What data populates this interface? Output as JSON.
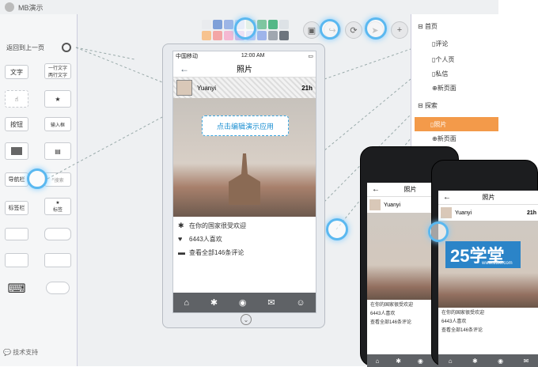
{
  "app": {
    "title": "MB演示",
    "support": "技术支持"
  },
  "sidebar": {
    "back": "返回到上一页",
    "text": "文字",
    "twoline": "一行文字\n两行文字",
    "button": "按钮",
    "input": "输入框",
    "navbar": "导航栏",
    "search": "搜索",
    "tabbar": "标签栏",
    "tab": "标签"
  },
  "toolbar": {
    "colors": [
      "#e9ebee",
      "#7fa0d8",
      "#9db5e6",
      "#c2d2f0",
      "#bcd9c5",
      "#7fc6a0",
      "#54b887",
      "#dde2e6",
      "#f7c38f",
      "#f3a6a6",
      "#f5b8d2",
      "#ceb5e6",
      "#b9c5f2",
      "#9fb4ea",
      "#a0a7b0",
      "#6d757e"
    ]
  },
  "phone": {
    "carrier": "中国移动",
    "time": "12:00 AM",
    "title": "照片",
    "user": "Yuanyi",
    "age": "21h",
    "edit": "点击编辑演示应用",
    "line1": "在你的国家很受欢迎",
    "line2": "6443人喜欢",
    "line3": "查看全部146条评论",
    "tabs": [
      "⌂",
      "✱",
      "◉",
      "✉",
      "☺"
    ]
  },
  "pages": {
    "home": "首页",
    "comments": "评论",
    "profile": "个人页",
    "messages": "私信",
    "newpage": "新页面",
    "explore": "探索",
    "photo": "照片",
    "newpage2": "新页面"
  },
  "preview": {
    "title": "照片",
    "user": "Yuanyi",
    "age": "21h",
    "line1": "在你的国家很受欢迎",
    "line2": "6443人喜欢",
    "line3": "查看全部146条评论",
    "logo": "25学堂",
    "logo_sub": "www.25xt.com"
  }
}
